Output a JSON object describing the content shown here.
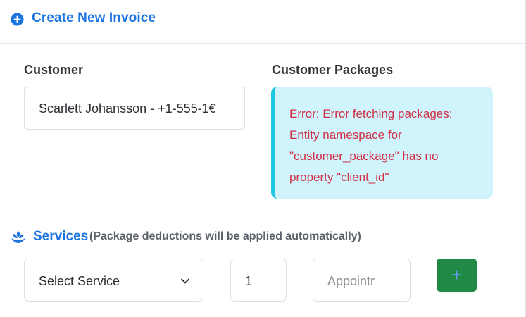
{
  "header": {
    "title": "Create New Invoice",
    "icon": "plus-circle-icon"
  },
  "customer": {
    "label": "Customer",
    "value": "Scarlett Johansson - +1-555-1€"
  },
  "packages": {
    "label": "Customer Packages",
    "error": "Error: Error fetching packages: Entity namespace for \"customer_package\" has no property \"client_id\""
  },
  "services": {
    "icon": "hand-holding-icon",
    "title": "Services",
    "note": "(Package deductions will be applied automatically)",
    "select_value": "Select Service",
    "quantity": "1",
    "appointment_placeholder": "Appointr",
    "add_button": "+"
  },
  "colors": {
    "accent": "#1c74e0",
    "alert_bg": "#cff4fc",
    "alert_border": "#1fc6e5",
    "error_text": "#d12f43",
    "success": "#1f8a45"
  }
}
